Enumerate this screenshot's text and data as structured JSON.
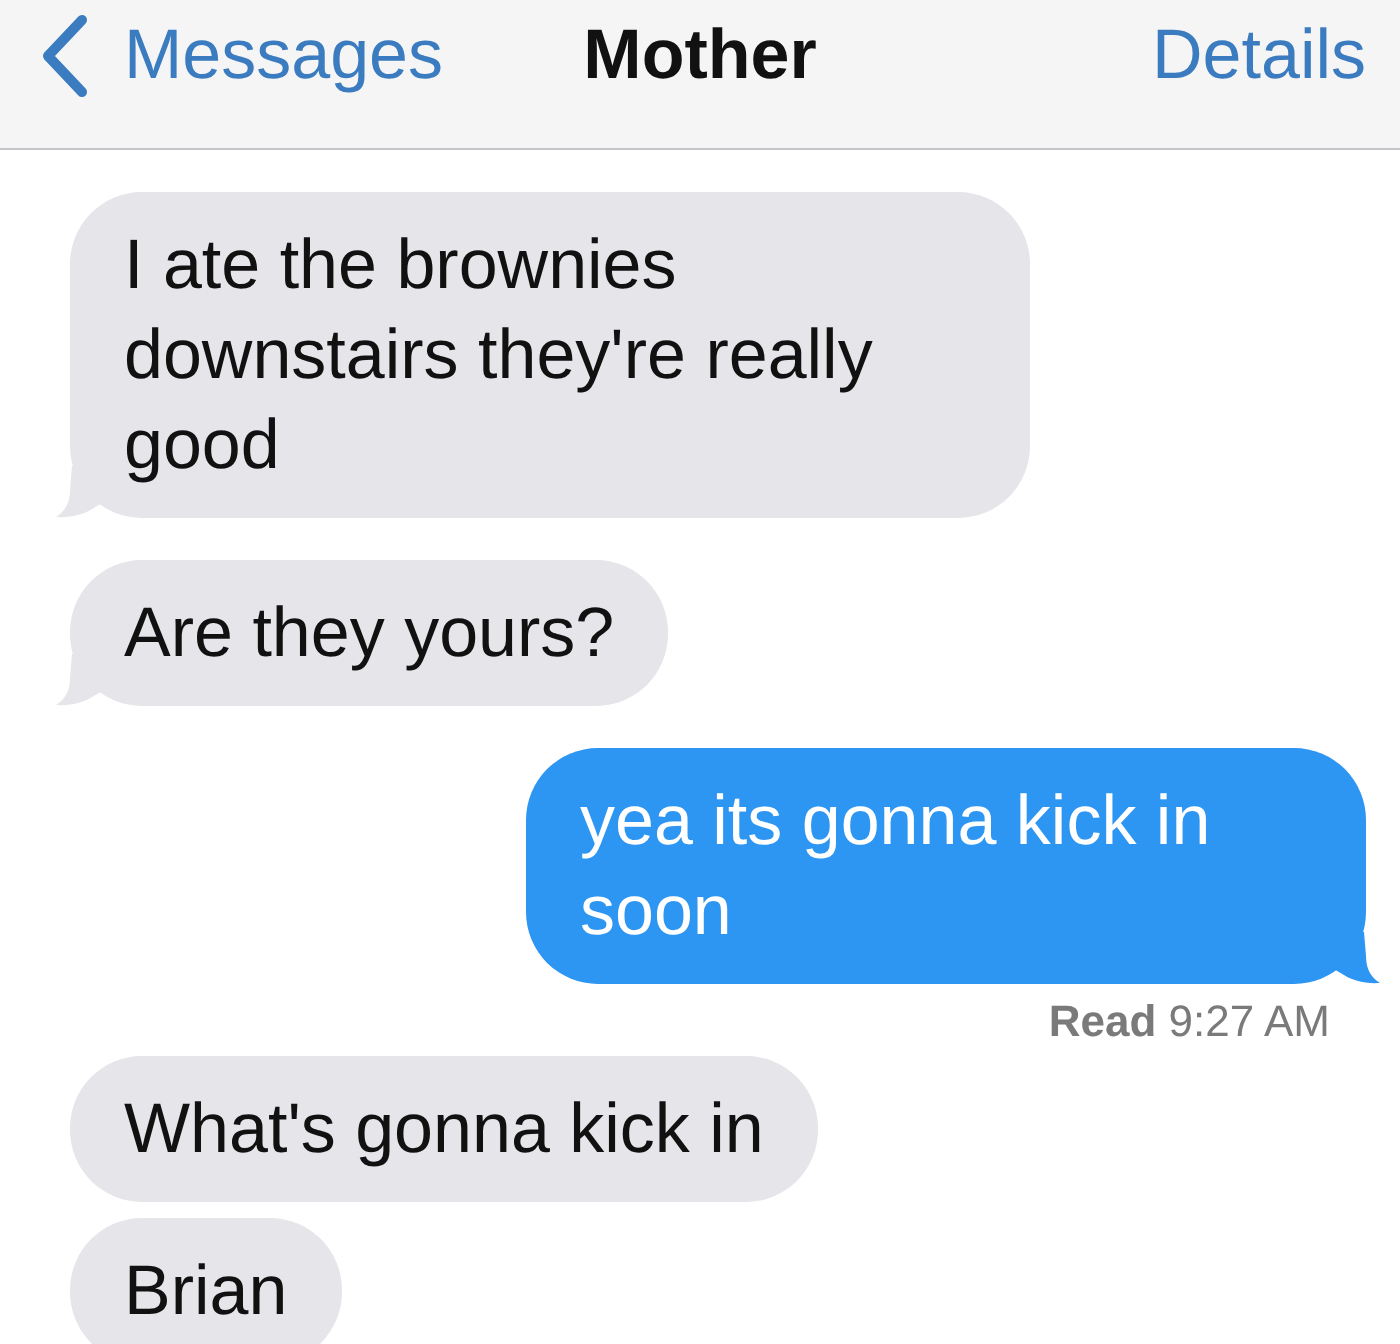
{
  "nav_bar": {
    "back": "Messages",
    "title": "Mother",
    "action": "Details"
  },
  "messages": [
    {
      "kind": "received",
      "text": "I ate the brownies downstairs they're really good",
      "tail": true
    },
    {
      "kind": "received",
      "text": "Are they yours?",
      "tail": true
    },
    {
      "kind": "sent",
      "text": "yea its gonna kick in soon",
      "tail": true,
      "receipt": "**Read** 9:27 AM"
    },
    {
      "kind": "received",
      "text": "What's gonna kick in",
      "tail": false
    },
    {
      "kind": "received",
      "text": "Brian",
      "tail": false
    }
  ]
}
